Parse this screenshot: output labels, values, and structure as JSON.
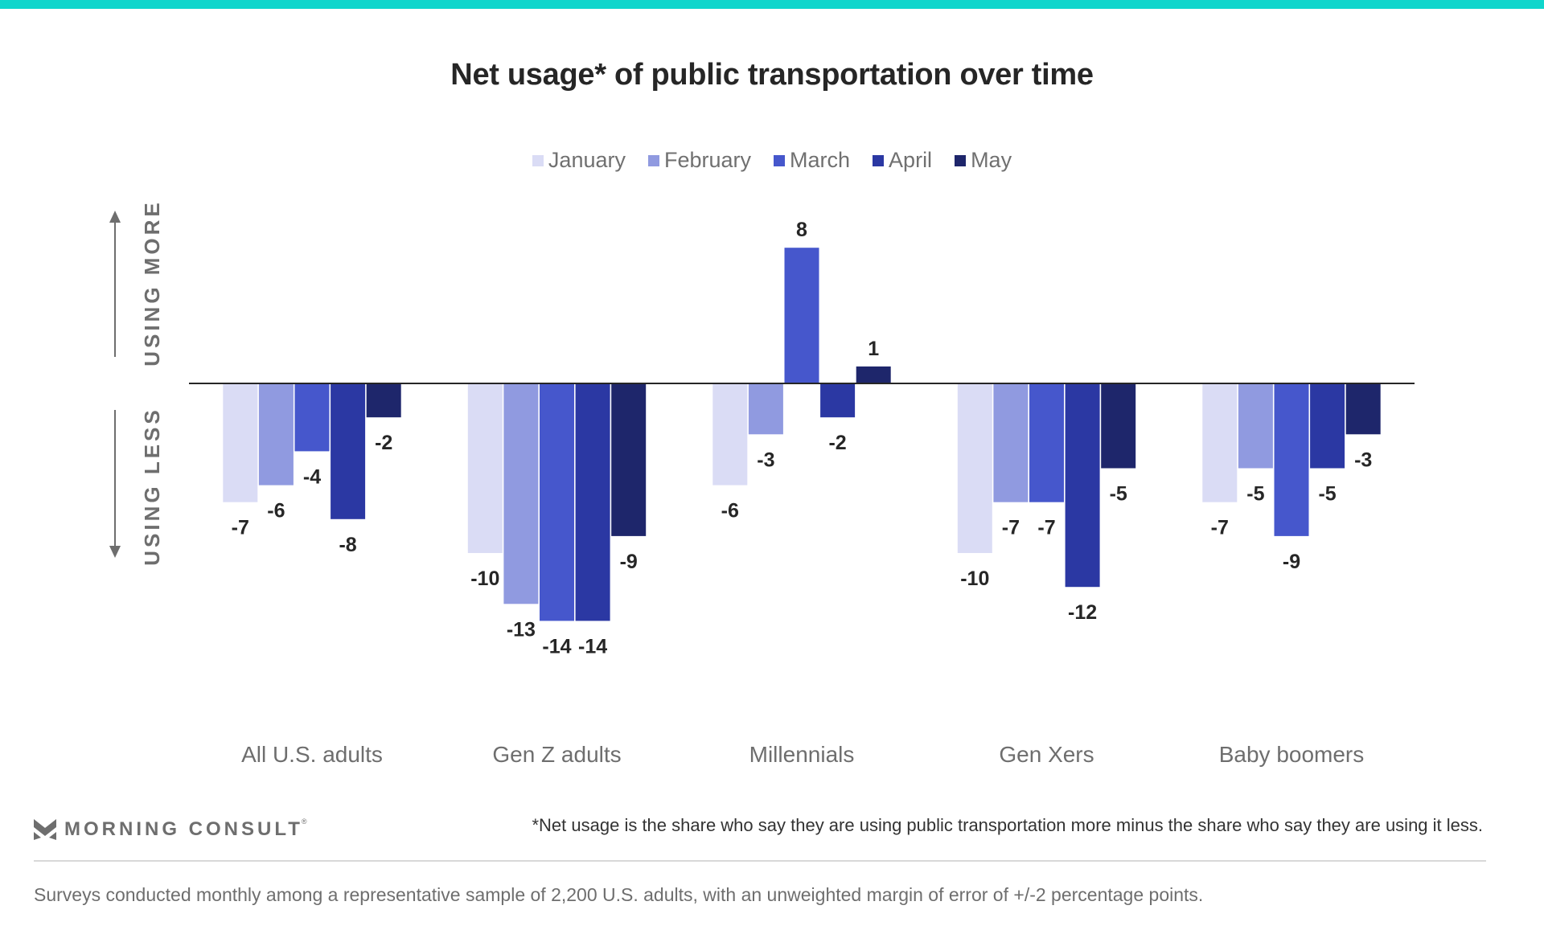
{
  "brand": {
    "accent_color": "#10d6cc",
    "logo_text": "MORNING CONSULT",
    "logo_mark": "registered"
  },
  "footnote": "*Net usage is the share who say they are using public transportation more minus the share who say they are using it less.",
  "source": "Surveys conducted monthly among a representative sample of 2,200 U.S. adults, with an unweighted margin of error of +/-2 percentage points.",
  "axis_annotations": {
    "up": "USING MORE",
    "down": "USING LESS"
  },
  "chart_data": {
    "type": "bar",
    "title": "Net usage* of public transportation over time",
    "xlabel": "",
    "ylabel": "",
    "categories": [
      "All U.S. adults",
      "Gen Z adults",
      "Millennials",
      "Gen Xers",
      "Baby boomers"
    ],
    "series": [
      {
        "name": "January",
        "color": "#dadcf5",
        "values": [
          -7,
          -10,
          -6,
          -10,
          -7
        ]
      },
      {
        "name": "February",
        "color": "#909ae0",
        "values": [
          -6,
          -13,
          -3,
          -7,
          -5
        ]
      },
      {
        "name": "March",
        "color": "#4657cc",
        "values": [
          -4,
          -14,
          8,
          -7,
          -9
        ]
      },
      {
        "name": "April",
        "color": "#2b38a3",
        "values": [
          -8,
          -14,
          -2,
          -12,
          -5
        ]
      },
      {
        "name": "May",
        "color": "#1e266b",
        "values": [
          -2,
          -9,
          1,
          -5,
          -3
        ]
      }
    ],
    "ylim": [
      -14,
      8
    ],
    "grid": false,
    "legend_position": "top-center",
    "data_labels": true
  }
}
